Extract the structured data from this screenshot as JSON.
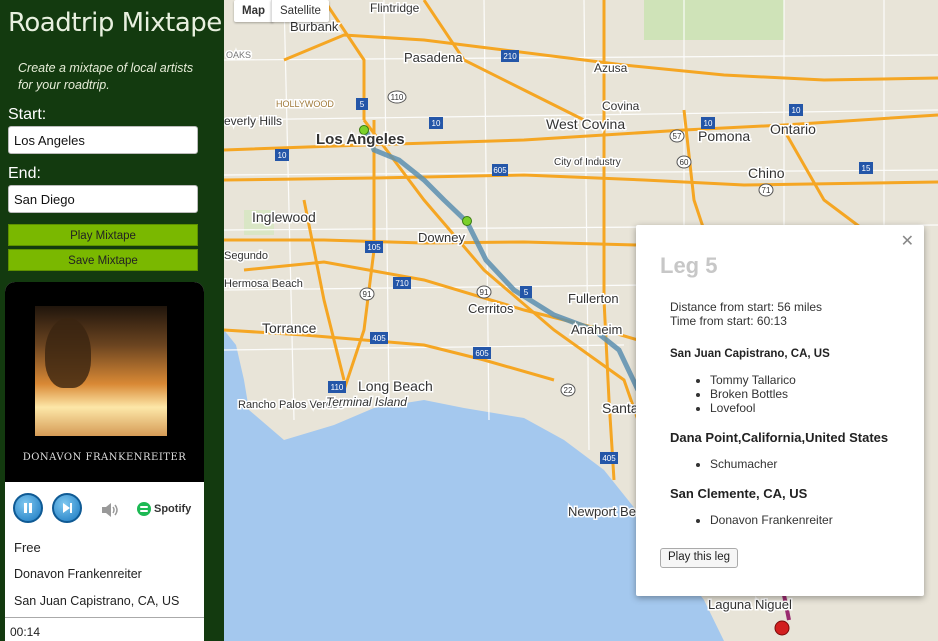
{
  "sidebar": {
    "title": "Roadtrip Mixtape",
    "tagline": "Create a mixtape of local artists for your roadtrip.",
    "start_label": "Start:",
    "start_value": "Los Angeles",
    "end_label": "End:",
    "end_value": "San Diego",
    "play_mixtape": "Play Mixtape",
    "save_mixtape": "Save Mixtape"
  },
  "player": {
    "album_artist_text": "DONAVON FRANKENREITER",
    "spotify_label": "Spotify",
    "track": "Free",
    "artist": "Donavon Frankenreiter",
    "location": "San Juan Capistrano, CA, US",
    "elapsed": "00:14",
    "icons": [
      "pause-icon",
      "next-icon",
      "volume-icon",
      "spotify-icon"
    ]
  },
  "map": {
    "map_type_map": "Map",
    "map_type_satellite": "Satellite",
    "cities": {
      "flintridge": "Flintridge",
      "burbank": "Burbank",
      "pasadena": "Pasadena",
      "azusa": "Azusa",
      "covina": "Covina",
      "hollywood": "HOLLYWOOD",
      "everly_hills": "everly Hills",
      "los_angeles": "Los Angeles",
      "west_covina": "West Covina",
      "pomona": "Pomona",
      "ontario": "Ontario",
      "city_of_industry": "City of Industry",
      "chino": "Chino",
      "inglewood": "Inglewood",
      "downey": "Downey",
      "segundo": "Segundo",
      "hermosa_beach": "Hermosa Beach",
      "fullerton": "Fullerton",
      "torrance": "Torrance",
      "cerritos": "Cerritos",
      "anaheim": "Anaheim",
      "long_beach": "Long Beach",
      "rancho_palos_verdes": "Rancho Palos Verdes",
      "terminal_island": "Terminal Island",
      "santa": "Santa",
      "newport_beach": "Newport Beach",
      "laguna_niguel": "Laguna Niguel",
      "oaks": "OAKS",
      "hills": "Hills",
      "o": "O"
    },
    "shields": {
      "i5a": "5",
      "i210": "210",
      "r110a": "110",
      "i10a": "10",
      "i605a": "605",
      "i10b": "10",
      "r60": "60",
      "i10c": "10",
      "i105": "105",
      "i710": "710",
      "r91a": "91",
      "r91b": "91",
      "i405a": "405",
      "i605b": "605",
      "i5b": "5",
      "r110b": "110",
      "r22": "22",
      "i405b": "405",
      "r57": "57",
      "r15": "15",
      "r71": "71",
      "i10d": "10"
    }
  },
  "popup": {
    "title": "Leg 5",
    "distance": "Distance from start: 56 miles",
    "time": "Time from start: 60:13",
    "stops": [
      {
        "name": "San Juan Capistrano, CA, US",
        "artists": [
          "Tommy Tallarico",
          "Broken Bottles",
          "Lovefool"
        ]
      },
      {
        "name": "Dana Point,California,United States",
        "artists": [
          "Schumacher"
        ]
      },
      {
        "name": "San Clemente, CA, US",
        "artists": [
          "Donavon Frankenreiter"
        ]
      }
    ],
    "play_leg": "Play this leg"
  },
  "colors": {
    "sidebar_bg": "#133a0f",
    "button_green": "#7ab800",
    "route": "#5c8fb0",
    "water": "#a4c8ee",
    "freeway": "#f5a623"
  }
}
